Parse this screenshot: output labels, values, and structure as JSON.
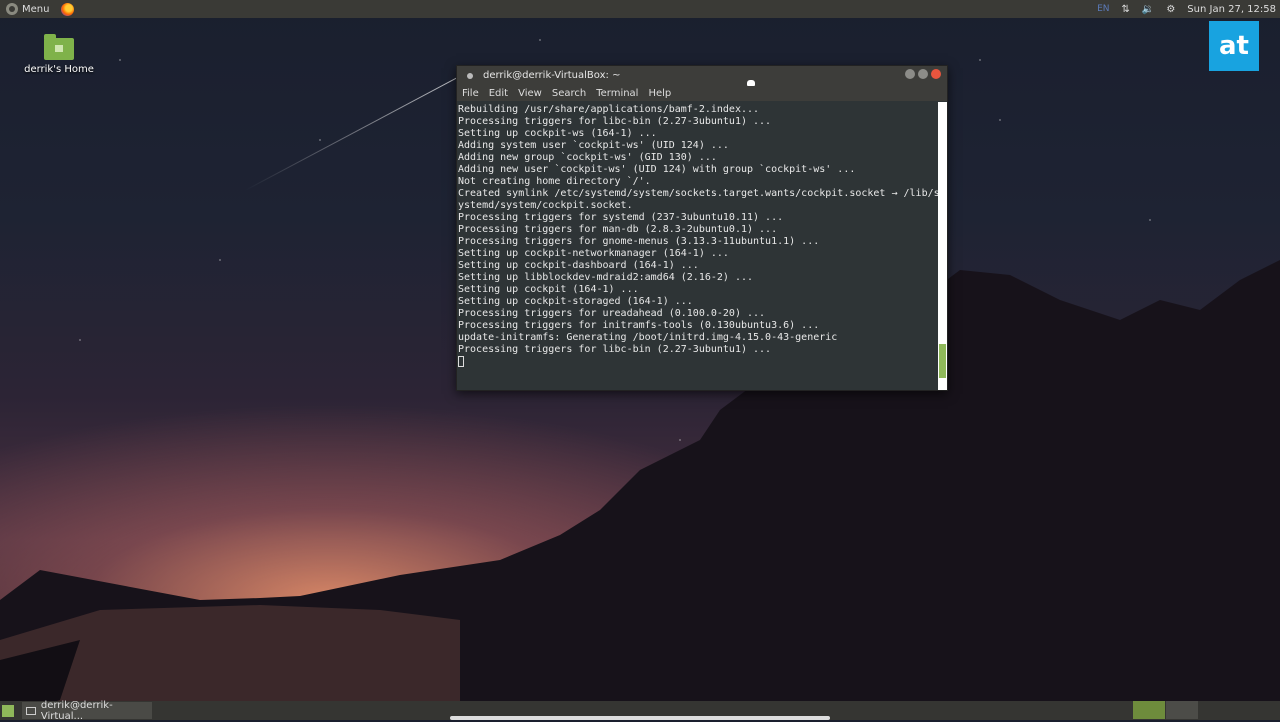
{
  "top_panel": {
    "menu_label": "Menu",
    "lang": "EN",
    "clock": "Sun Jan 27, 12:58"
  },
  "desktop": {
    "icons": [
      {
        "label": "derrik's Home",
        "icon": "folder-home-icon"
      }
    ]
  },
  "logo": {
    "text": "at",
    "color": "#18a3e0"
  },
  "terminal": {
    "title": "derrik@derrik-VirtualBox: ~",
    "menu": [
      "File",
      "Edit",
      "View",
      "Search",
      "Terminal",
      "Help"
    ],
    "lines": [
      "Rebuilding /usr/share/applications/bamf-2.index...",
      "Processing triggers for libc-bin (2.27-3ubuntu1) ...",
      "Setting up cockpit-ws (164-1) ...",
      "Adding system user `cockpit-ws' (UID 124) ...",
      "Adding new group `cockpit-ws' (GID 130) ...",
      "Adding new user `cockpit-ws' (UID 124) with group `cockpit-ws' ...",
      "Not creating home directory `/'.",
      "Created symlink /etc/systemd/system/sockets.target.wants/cockpit.socket → /lib/s",
      "ystemd/system/cockpit.socket.",
      "Processing triggers for systemd (237-3ubuntu10.11) ...",
      "Processing triggers for man-db (2.8.3-2ubuntu0.1) ...",
      "Processing triggers for gnome-menus (3.13.3-11ubuntu1.1) ...",
      "Setting up cockpit-networkmanager (164-1) ...",
      "Setting up cockpit-dashboard (164-1) ...",
      "Setting up libblockdev-mdraid2:amd64 (2.16-2) ...",
      "Setting up cockpit (164-1) ...",
      "Setting up cockpit-storaged (164-1) ...",
      "Processing triggers for ureadahead (0.100.0-20) ...",
      "Processing triggers for initramfs-tools (0.130ubuntu3.6) ...",
      "update-initramfs: Generating /boot/initrd.img-4.15.0-43-generic",
      "Processing triggers for libc-bin (2.27-3ubuntu1) ..."
    ]
  },
  "taskbar": {
    "tasks": [
      {
        "label": "derrik@derrik-Virtual..."
      }
    ]
  },
  "colors": {
    "accent": "#8fb85a",
    "close": "#e8553e"
  }
}
